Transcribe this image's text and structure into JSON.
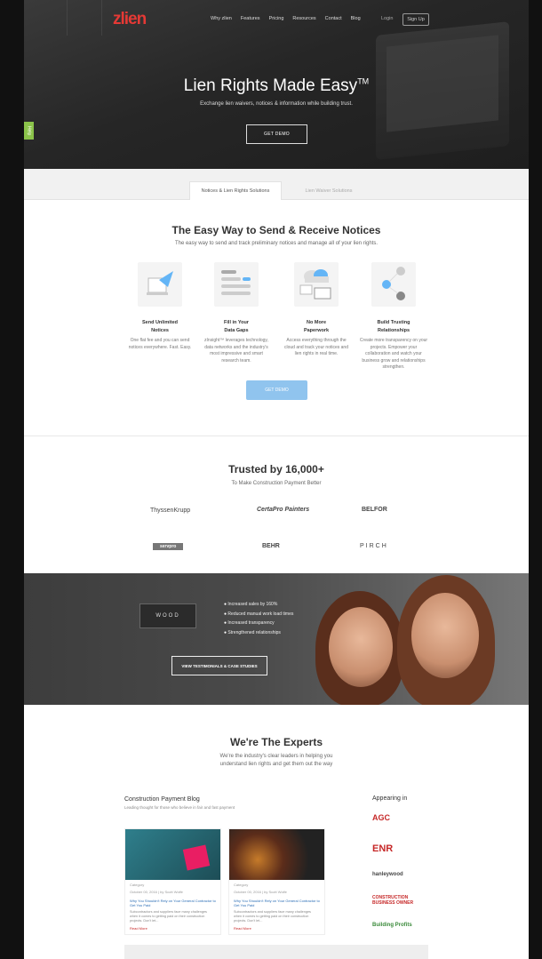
{
  "nav": {
    "logo_z": "z",
    "logo_rest": "lien",
    "links": [
      "Why zlien",
      "Features",
      "Pricing",
      "Resources",
      "Contact",
      "Blog"
    ],
    "login": "Login",
    "signup": "Sign Up"
  },
  "help_tab": "Help",
  "hero": {
    "title": "Lien Rights Made Easy",
    "title_mark": "TM",
    "subtitle": "Exchange lien waivers, notices & information while building trust.",
    "cta": "GET DEMO"
  },
  "tabs": {
    "active": "Notices & Lien Rights Solutions",
    "inactive": "Lien Waiver Solutions"
  },
  "features": {
    "title": "The Easy Way to Send & Receive Notices",
    "subtitle": "The easy way to send and track preliminary notices and manage all of your lien rights.",
    "cards": [
      {
        "h1": "Send Unlimited",
        "h2": "Notices",
        "desc": "One flat fee and you can send notices everywhere. Fast. Easy."
      },
      {
        "h1": "Fill in Your",
        "h2": "Data Gaps",
        "desc": "zInsight™ leverages technology, data networks and the industry's most impressive and smart research team."
      },
      {
        "h1": "No More",
        "h2": "Paperwork",
        "desc": "Access everything through the cloud and track your notices and lien rights in real time."
      },
      {
        "h1": "Build Trusting",
        "h2": "Relationships",
        "desc": "Create more transparency on your projects. Empower your collaboration and watch your business grow and relationships strengthen."
      }
    ],
    "cta": "GET DEMO"
  },
  "trusted": {
    "title": "Trusted by 16,000+",
    "subtitle": "To Make Construction Payment Better",
    "logos": [
      "ThyssenKrupp",
      "CertaPro Painters",
      "BELFOR",
      "servpro",
      "BEHR",
      "PIRCH"
    ]
  },
  "testimonial": {
    "brand": "WOOD",
    "bullets": [
      "Increased sales by 160%",
      "Reduced manual work load times",
      "Increased transparency",
      "Strengthened relationships"
    ],
    "cta": "VIEW TESTIMONIALS & CASE STUDIES"
  },
  "experts": {
    "title": "We're The Experts",
    "subtitle_1": "We're the industry's clear leaders in helping you",
    "subtitle_2": "understand lien rights and get them out the way",
    "blog_title": "Construction Payment Blog",
    "blog_sub": "Leading thought for those who believe in fair and fast payment",
    "posts": [
      {
        "category": "Category",
        "meta": "October 00, 2016 | by Scott Wolfe",
        "title": "Why You Shouldn't Rely on Your General Contractor to Get You Paid",
        "excerpt": "Subcontractors and suppliers face many challenges when it comes to getting paid on their construction projects. Don't let...",
        "read": "Read More"
      },
      {
        "category": "Category",
        "meta": "October 00, 2016 | by Scott Wolfe",
        "title": "Why You Shouldn't Rely on Your General Contractor to Get You Paid",
        "excerpt": "Subcontractors and suppliers face many challenges when it comes to getting paid on their construction projects. Don't let...",
        "read": "Read More"
      }
    ],
    "appearing_in": "Appearing in",
    "publications": [
      "AGC",
      "ENR",
      "hanleywood",
      "CONSTRUCTION BUSINESS OWNER",
      "Building Profits"
    ]
  },
  "colors": {
    "brand_red": "#e53935",
    "demo_blue": "#90c4ee",
    "help_green": "#8bc34a"
  }
}
